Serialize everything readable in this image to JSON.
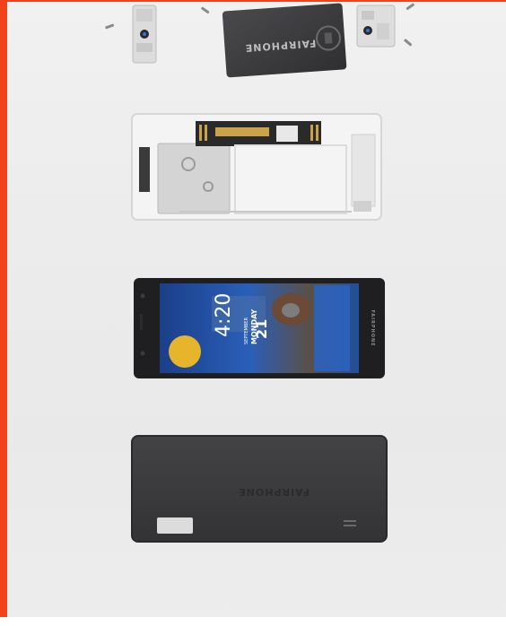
{
  "scene": {
    "description_tag": "exploded view of modular smartphone",
    "colors": {
      "background": "#ececec",
      "accent": "#f2421b",
      "battery": "#3b3b3d",
      "phone_back": "#3a3a3c",
      "screen_frame": "#1f1f21"
    }
  },
  "battery": {
    "brand": "FAIRPHONE"
  },
  "display": {
    "brand": "FAIRPHONE",
    "lockscreen": {
      "time": "4:20",
      "date_day": "21",
      "weekday": "MONDAY",
      "month": "SEPTEMBER"
    }
  },
  "back_cover": {
    "brand": "FAIRPHONE"
  }
}
